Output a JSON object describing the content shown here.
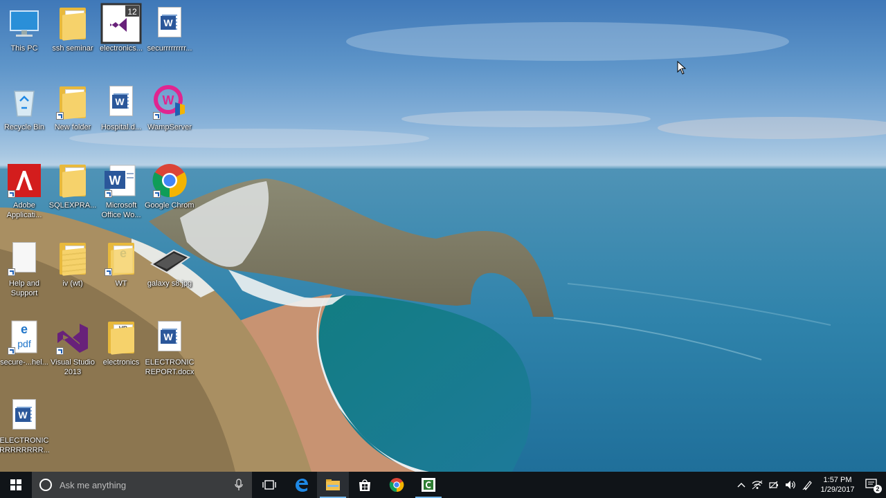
{
  "desktop": {
    "icons": [
      {
        "label": "This PC",
        "kind": "pc"
      },
      {
        "label": "ssh seminar",
        "kind": "folder"
      },
      {
        "label": "electronics...",
        "kind": "vs-project",
        "badge": "12"
      },
      {
        "label": "securrrrrrrrr...",
        "kind": "word-doc"
      },
      {
        "label": "Recycle Bin",
        "kind": "recycle"
      },
      {
        "label": "New folder",
        "kind": "folder-pdf"
      },
      {
        "label": "Hospital.d...",
        "kind": "word-doc"
      },
      {
        "label": "WampServer",
        "kind": "wamp"
      },
      {
        "label": "Adobe Applicati...",
        "kind": "adobe"
      },
      {
        "label": "SQLEXPRA...",
        "kind": "folder"
      },
      {
        "label": "Microsoft Office Wo...",
        "kind": "word"
      },
      {
        "label": "Google Chrome",
        "kind": "chrome"
      },
      {
        "label": "Help and Support",
        "kind": "blank-doc"
      },
      {
        "label": "iv (wt)",
        "kind": "folder-doc"
      },
      {
        "label": "WT",
        "kind": "folder-edge"
      },
      {
        "label": "galaxy s8.jpg",
        "kind": "image"
      },
      {
        "label": "secure-...hel...",
        "kind": "pdf"
      },
      {
        "label": "Visual Studio 2013",
        "kind": "vs"
      },
      {
        "label": "electronics",
        "kind": "folder-vb"
      },
      {
        "label": "ELECTRONIC REPORT.docx",
        "kind": "word-doc"
      },
      {
        "label": "ELECTRONIC RRRRRRRR...",
        "kind": "word-doc"
      }
    ]
  },
  "taskbar": {
    "search_placeholder": "Ask me anything",
    "clock_time": "1:57 PM",
    "clock_date": "1/29/2017",
    "notification_count": "2",
    "pinned": [
      "task-view",
      "edge",
      "file-explorer",
      "store",
      "chrome",
      "camtasia"
    ]
  },
  "colors": {
    "taskbar": "#101418",
    "accent": "#76b9ed",
    "search": "#3a3c3e"
  }
}
